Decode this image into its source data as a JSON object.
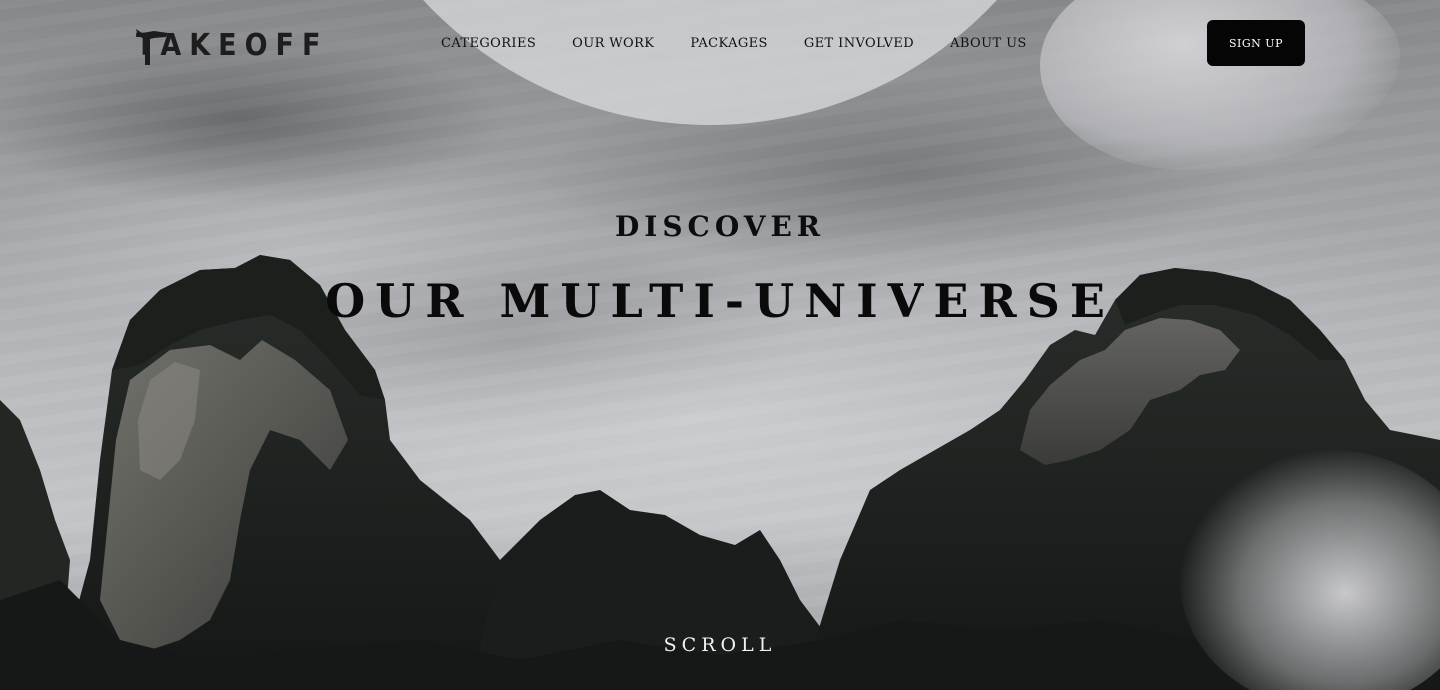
{
  "brand": {
    "logo_text": "TAKEOFF",
    "logo_icon": "airplane-t-icon"
  },
  "nav": {
    "items": [
      {
        "label": "CATEGORIES"
      },
      {
        "label": "OUR WORK"
      },
      {
        "label": "PACKAGES"
      },
      {
        "label": "GET INVOLVED"
      },
      {
        "label": "ABOUT US"
      }
    ],
    "signup_label": "SIGN UP"
  },
  "hero": {
    "eyebrow": "DISCOVER",
    "title": "OUR MULTI-UNIVERSE",
    "scroll_label": "SCROLL",
    "background": "misty-karst-mountains-under-cloudy-sky"
  },
  "colors": {
    "button_bg": "#050505",
    "button_text": "#ffffff",
    "heading_text": "#0a0a0a",
    "scroll_text": "#f1f1f1",
    "mountain_dark": "#1f2320"
  }
}
